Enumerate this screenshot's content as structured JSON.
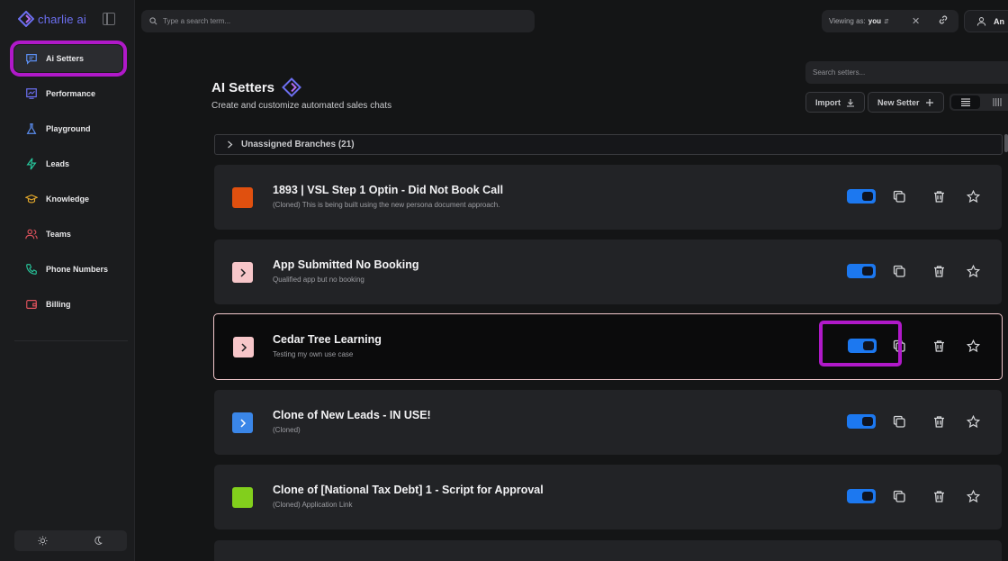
{
  "app": {
    "name": "charlie ai"
  },
  "sidebar": {
    "items": [
      {
        "label": "Ai Setters",
        "icon": "chat-icon"
      },
      {
        "label": "Performance",
        "icon": "chart-icon"
      },
      {
        "label": "Playground",
        "icon": "flask-icon"
      },
      {
        "label": "Leads",
        "icon": "bolt-icon"
      },
      {
        "label": "Knowledge",
        "icon": "graduation-cap-icon"
      },
      {
        "label": "Teams",
        "icon": "users-icon"
      },
      {
        "label": "Phone Numbers",
        "icon": "phone-icon"
      },
      {
        "label": "Billing",
        "icon": "wallet-icon"
      }
    ],
    "theme": {
      "light_icon": "sun-icon",
      "dark_icon": "moon-icon"
    }
  },
  "topbar": {
    "search_placeholder": "Type a search term...",
    "viewing_prefix": "Viewing as:",
    "viewing_user": "you",
    "user_label": "An"
  },
  "header": {
    "title": "AI Setters",
    "subtitle": "Create and customize automated sales chats",
    "search_placeholder": "Search setters...",
    "import_label": "Import",
    "new_setter_label": "New Setter"
  },
  "branches": {
    "label": "Unassigned Branches (21)"
  },
  "setters": [
    {
      "title": "1893 | VSL Step 1 Optin - Did Not Book Call",
      "description": "(Cloned) This is being built using the new persona document approach.",
      "color": "#e0500f",
      "has_chevron": false,
      "enabled": true
    },
    {
      "title": "App Submitted No Booking",
      "description": "Qualified app but no booking",
      "color": "#f7c6c9",
      "has_chevron": true,
      "enabled": true
    },
    {
      "title": "Cedar Tree Learning",
      "description": "Testing my own use case",
      "color": "#f7c6c9",
      "has_chevron": true,
      "enabled": true,
      "selected": true
    },
    {
      "title": "Clone of New Leads - IN USE!",
      "description": "(Cloned)",
      "color": "#3a86e8",
      "has_chevron": true,
      "enabled": true
    },
    {
      "title": "Clone of [National Tax Debt] 1 - Script for Approval",
      "description": "(Cloned) Application Link",
      "color": "#82cf1c",
      "has_chevron": false,
      "enabled": true
    }
  ],
  "colors": {
    "accent": "#1c78f0",
    "highlight": "#b019c9",
    "brand": "#6c6ff0"
  }
}
